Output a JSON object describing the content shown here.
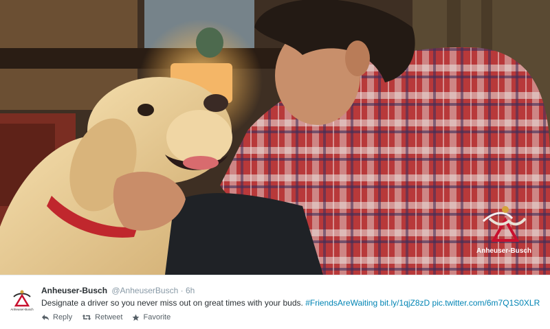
{
  "photo": {
    "watermark_text": "Anheuser-Busch"
  },
  "tweet": {
    "author_name": "Anheuser-Busch",
    "handle": "@AnheuserBusch",
    "separator": "·",
    "time": "6h",
    "text": "Designate a driver so you never miss out on great times with your buds.",
    "hashtag": "#FriendsAreWaiting",
    "short_link": "bit.ly/1qjZ8zD",
    "pic_link": "pic.twitter.com/6m7Q1S0XLR",
    "actions": [
      {
        "label": "Reply",
        "icon": "reply-icon"
      },
      {
        "label": "Retweet",
        "icon": "retweet-icon"
      },
      {
        "label": "Favorite",
        "icon": "star-icon"
      }
    ]
  },
  "avatar_label": "Anheuser-Busch",
  "colors": {
    "link": "#0084b4",
    "text": "#292f33",
    "muted": "#8899a6",
    "logo_red": "#c8102e",
    "logo_gold": "#d4a23a"
  }
}
